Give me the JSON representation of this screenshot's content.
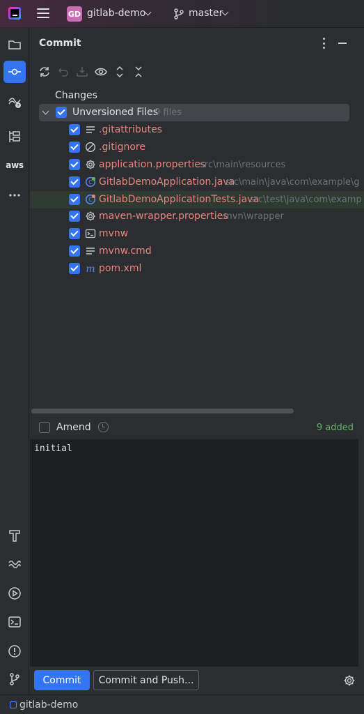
{
  "titlebar": {
    "project_initials": "GD",
    "project_name": "gitlab-demo",
    "branch": "master"
  },
  "left_strip": {
    "top_items": [
      "project-icon",
      "commit-icon",
      "pull-requests-icon",
      "structure-icon",
      "aws-icon",
      "more-icon"
    ],
    "aws_label": "aws",
    "bottom_items": [
      "build-icon",
      "services-icon",
      "run-icon",
      "terminal-icon",
      "problems-icon",
      "git-icon"
    ]
  },
  "commit_panel": {
    "title": "Commit",
    "toolbar": [
      "refresh-icon",
      "rollback-icon",
      "shelve-icon",
      "preview-icon",
      "expand-all-icon",
      "collapse-all-icon"
    ],
    "changes_label": "Changes",
    "group": {
      "label": "Unversioned Files",
      "count": "9 files"
    },
    "files": [
      {
        "name": ".gitattributes",
        "path": "",
        "icon": "text-file-icon"
      },
      {
        "name": ".gitignore",
        "path": "",
        "icon": "ignore-file-icon"
      },
      {
        "name": "application.properties",
        "path": "src\\main\\resources",
        "icon": "config-file-icon"
      },
      {
        "name": "GitlabDemoApplication.java",
        "path": "src\\main\\java\\com\\example\\g",
        "icon": "spring-class-icon"
      },
      {
        "name": "GitlabDemoApplicationTests.java",
        "path": "src\\test\\java\\com\\examp",
        "icon": "spring-test-class-icon"
      },
      {
        "name": "maven-wrapper.properties",
        "path": ".mvn\\wrapper",
        "icon": "config-file-icon"
      },
      {
        "name": "mvnw",
        "path": "",
        "icon": "shell-script-icon"
      },
      {
        "name": "mvnw.cmd",
        "path": "",
        "icon": "text-file-icon"
      },
      {
        "name": "pom.xml",
        "path": "",
        "icon": "maven-icon"
      }
    ],
    "amend_label": "Amend",
    "added_count": "9 added",
    "commit_message": "initial",
    "commit_button": "Commit",
    "commit_push_button": "Commit and Push..."
  },
  "statusbar": {
    "project": "gitlab-demo"
  },
  "colors": {
    "accent": "#3574f0",
    "unversioned_file": "#e8867f",
    "added_status": "#5fb865"
  }
}
